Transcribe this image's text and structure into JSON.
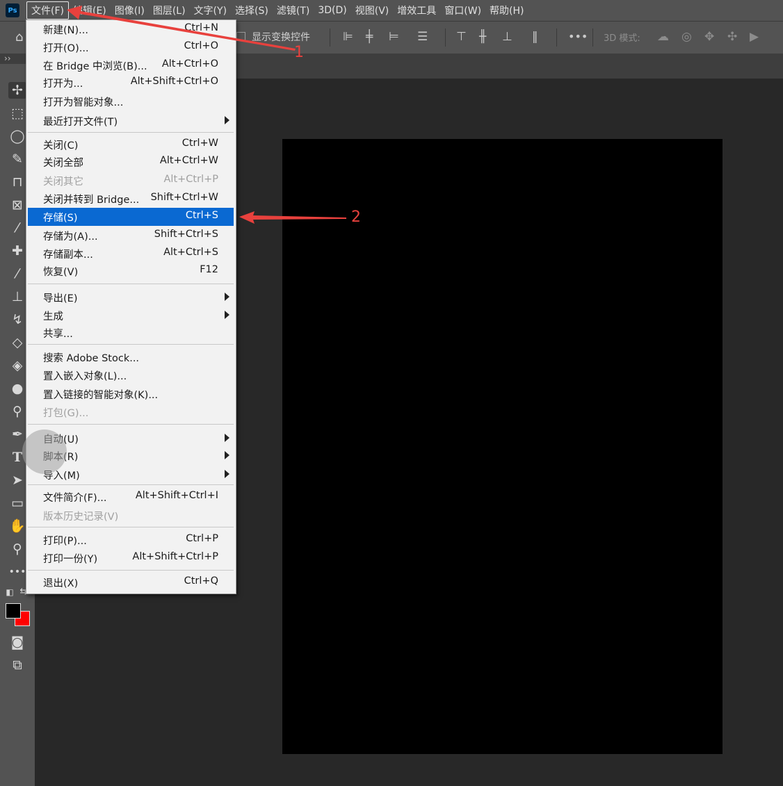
{
  "app": {
    "logo": "Ps"
  },
  "menubar": [
    "文件(F)",
    "编辑(E)",
    "图像(I)",
    "图层(L)",
    "文字(Y)",
    "选择(S)",
    "滤镜(T)",
    "3D(D)",
    "视图(V)",
    "增效工具",
    "窗口(W)",
    "帮助(H)"
  ],
  "optionsbar": {
    "transform_label": "显示变换控件",
    "mode_label": "3D 模式:"
  },
  "file_menu": {
    "items": [
      {
        "label": "新建(N)...",
        "shortcut": "Ctrl+N"
      },
      {
        "label": "打开(O)...",
        "shortcut": "Ctrl+O"
      },
      {
        "label": "在 Bridge 中浏览(B)...",
        "shortcut": "Alt+Ctrl+O"
      },
      {
        "label": "打开为...",
        "shortcut": "Alt+Shift+Ctrl+O"
      },
      {
        "label": "打开为智能对象...",
        "shortcut": ""
      },
      {
        "label": "最近打开文件(T)",
        "shortcut": ""
      },
      {
        "label": "关闭(C)",
        "shortcut": "Ctrl+W"
      },
      {
        "label": "关闭全部",
        "shortcut": "Alt+Ctrl+W"
      },
      {
        "label": "关闭其它",
        "shortcut": "Alt+Ctrl+P"
      },
      {
        "label": "关闭并转到 Bridge...",
        "shortcut": "Shift+Ctrl+W"
      },
      {
        "label": "存储(S)",
        "shortcut": "Ctrl+S"
      },
      {
        "label": "存储为(A)...",
        "shortcut": "Shift+Ctrl+S"
      },
      {
        "label": "存储副本...",
        "shortcut": "Alt+Ctrl+S"
      },
      {
        "label": "恢复(V)",
        "shortcut": "F12"
      },
      {
        "label": "导出(E)",
        "shortcut": ""
      },
      {
        "label": "生成",
        "shortcut": ""
      },
      {
        "label": "共享...",
        "shortcut": ""
      },
      {
        "label": "搜索 Adobe Stock...",
        "shortcut": ""
      },
      {
        "label": "置入嵌入对象(L)...",
        "shortcut": ""
      },
      {
        "label": "置入链接的智能对象(K)...",
        "shortcut": ""
      },
      {
        "label": "打包(G)...",
        "shortcut": ""
      },
      {
        "label": "自动(U)",
        "shortcut": ""
      },
      {
        "label": "脚本(R)",
        "shortcut": ""
      },
      {
        "label": "导入(M)",
        "shortcut": ""
      },
      {
        "label": "文件简介(F)...",
        "shortcut": "Alt+Shift+Ctrl+I"
      },
      {
        "label": "版本历史记录(V)",
        "shortcut": ""
      },
      {
        "label": "打印(P)...",
        "shortcut": "Ctrl+P"
      },
      {
        "label": "打印一份(Y)",
        "shortcut": "Alt+Shift+Ctrl+P"
      },
      {
        "label": "退出(X)",
        "shortcut": "Ctrl+Q"
      }
    ]
  },
  "annotations": {
    "step1": "1",
    "step2": "2",
    "color": "#e8413d"
  },
  "colors": {
    "foreground": "#000000",
    "background": "#ff0000",
    "highlight": "#0a69d2"
  },
  "tools": [
    "move-icon",
    "marquee-icon",
    "lasso-icon",
    "quick-select-icon",
    "crop-icon",
    "frame-icon",
    "eyedropper-icon",
    "healing-icon",
    "brush-icon",
    "stamp-icon",
    "history-brush-icon",
    "eraser-icon",
    "paint-bucket-icon",
    "blur-icon",
    "dodge-icon",
    "pen-icon",
    "type-icon",
    "path-select-icon",
    "rectangle-icon",
    "hand-icon",
    "zoom-icon",
    "more-icon",
    "quick-mask-icon",
    "screen-mode-icon"
  ]
}
